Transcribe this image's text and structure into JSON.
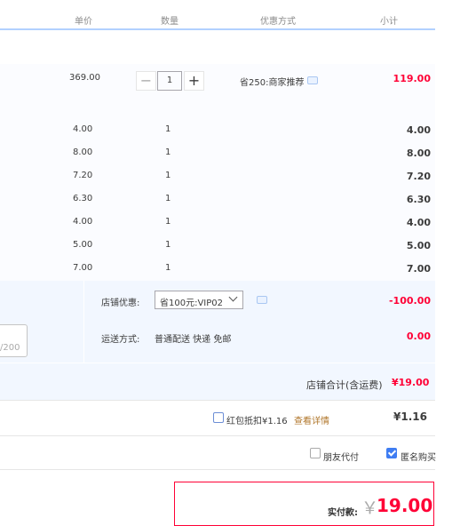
{
  "header": {
    "unit_price": "单价",
    "quantity": "数量",
    "discount_method": "优惠方式",
    "subtotal": "小计"
  },
  "main_item": {
    "price": "369.00",
    "quantity": "1",
    "promo": "省250:商家推荐",
    "subtotal": "119.00"
  },
  "sub_items": [
    {
      "price": "4.00",
      "quantity": "1",
      "subtotal": "4.00"
    },
    {
      "price": "8.00",
      "quantity": "1",
      "subtotal": "8.00"
    },
    {
      "price": "7.20",
      "quantity": "1",
      "subtotal": "7.20"
    },
    {
      "price": "6.30",
      "quantity": "1",
      "subtotal": "6.30"
    },
    {
      "price": "4.00",
      "quantity": "1",
      "subtotal": "4.00"
    },
    {
      "price": "5.00",
      "quantity": "1",
      "subtotal": "5.00"
    },
    {
      "price": "7.00",
      "quantity": "1",
      "subtotal": "7.00"
    }
  ],
  "shop": {
    "discount_label": "店铺优惠:",
    "discount_selected": "省100元:VIP02",
    "discount_amount": "-100.00",
    "shipping_label": "运送方式:",
    "shipping_value": "普通配送 快递 免邮",
    "shipping_cost": "0.00",
    "message_counter": "/200",
    "total_label": "店铺合计(含运费)",
    "total_value": "¥19.00"
  },
  "redpacket": {
    "label": "红包抵扣¥1.16",
    "details_link": "查看详情",
    "amount": "¥1.16"
  },
  "options": {
    "friend_pay": "朋友代付",
    "anonymous": "匿名购买"
  },
  "payment": {
    "label": "实付款:",
    "currency": "￥",
    "amount": "19.00"
  },
  "colors": {
    "accent_red": "#ff0036",
    "header_line": "#b2d1ff",
    "panel_bg": "#f2f7ff"
  },
  "icons": [
    "minus-icon",
    "plus-icon",
    "chat-icon",
    "chevron-down-icon",
    "checkbox-icon"
  ]
}
